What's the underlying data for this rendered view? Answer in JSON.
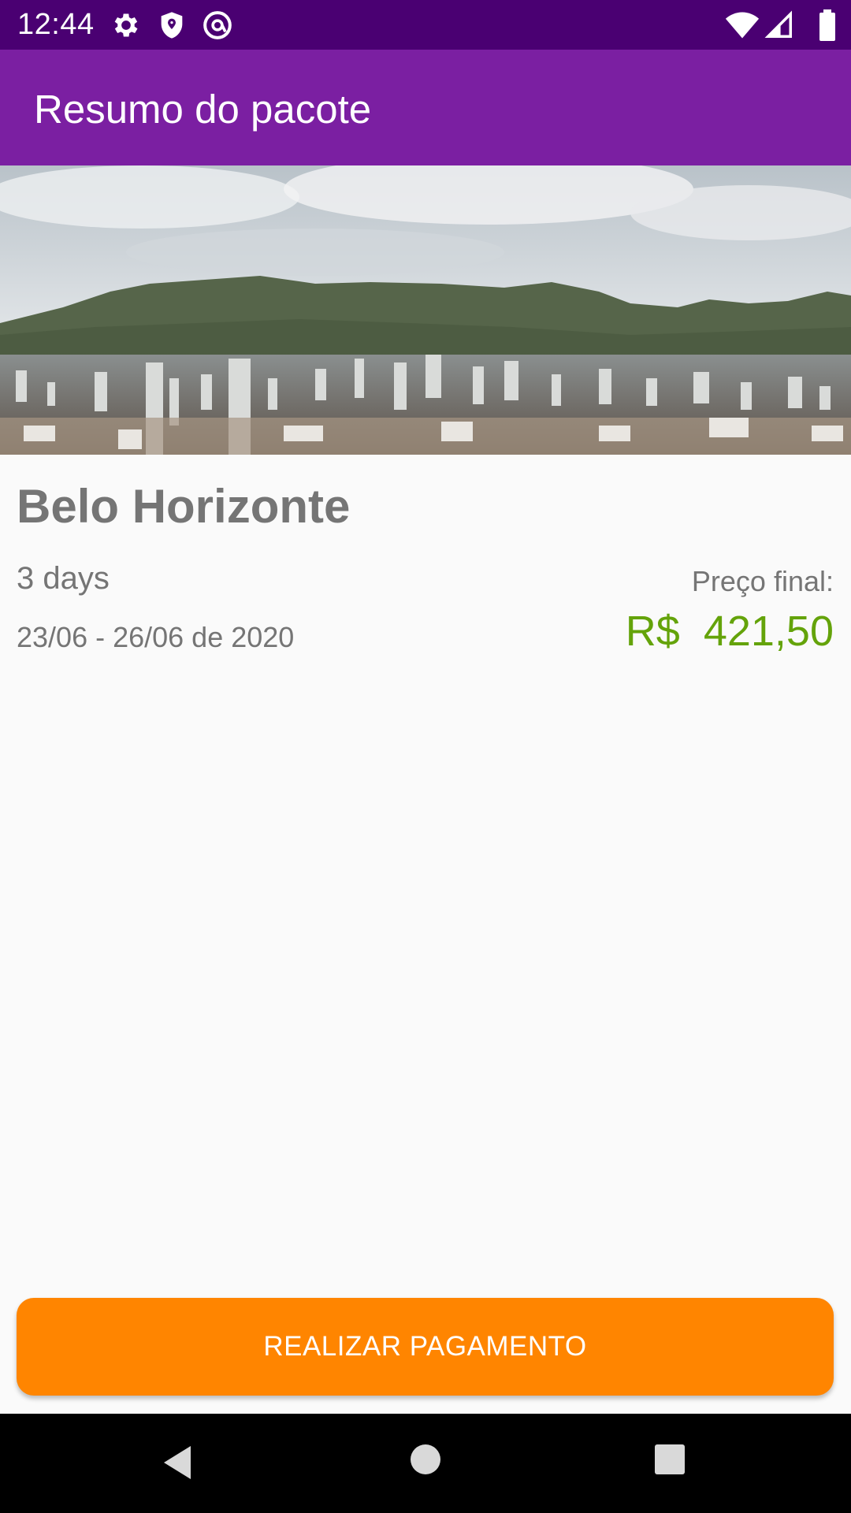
{
  "status_bar": {
    "time": "12:44",
    "icons_left": [
      "gear-icon",
      "shield-icon",
      "vpn-at-icon"
    ],
    "icons_right": [
      "wifi-icon",
      "signal-icon",
      "battery-icon"
    ]
  },
  "app_bar": {
    "title": "Resumo do pacote",
    "color": "#7b1fa2"
  },
  "package": {
    "city": "Belo Horizonte",
    "duration": "3 days",
    "dates": "23/06 - 26/06 de 2020",
    "price_label": "Preço final:",
    "price_value": "R$  421,50",
    "price_color": "#64a30a"
  },
  "actions": {
    "pay_label": "REALIZAR PAGAMENTO",
    "pay_color": "#ff8500"
  },
  "nav_bar": {
    "icons": [
      "back-icon",
      "home-icon",
      "recents-icon"
    ]
  }
}
